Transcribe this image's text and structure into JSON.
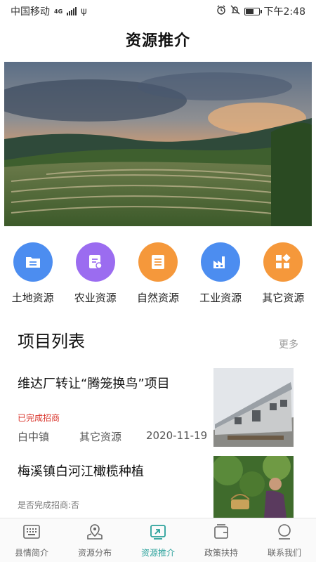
{
  "status_bar": {
    "carrier": "中国移动",
    "network": "4G",
    "time": "下午2:48"
  },
  "header": {
    "title": "资源推介"
  },
  "categories": [
    {
      "label": "土地资源",
      "icon": "folder-icon",
      "color": "#4c8df0"
    },
    {
      "label": "农业资源",
      "icon": "certificate-icon",
      "color": "#9b6cf0"
    },
    {
      "label": "自然资源",
      "icon": "list-icon",
      "color": "#f5983b"
    },
    {
      "label": "工业资源",
      "icon": "factory-icon",
      "color": "#4c8df0"
    },
    {
      "label": "其它资源",
      "icon": "grid-icon",
      "color": "#f5983b"
    }
  ],
  "projects_section": {
    "title": "项目列表",
    "more": "更多"
  },
  "projects": [
    {
      "title": "维达厂转让“腾笼换鸟”项目",
      "status": "已完成招商",
      "status_color": "#d9342b",
      "town": "白中镇",
      "category": "其它资源",
      "date": "2020-11-19"
    },
    {
      "title": "梅溪镇白河江橄榄种植",
      "status": "是否完成招商:否",
      "status_color": "#777"
    }
  ],
  "tabs": [
    {
      "label": "县情简介",
      "icon": "keyboard-icon",
      "active": false
    },
    {
      "label": "资源分布",
      "icon": "map-pin-icon",
      "active": false
    },
    {
      "label": "资源推介",
      "icon": "share-icon",
      "active": true
    },
    {
      "label": "政策扶持",
      "icon": "wallet-icon",
      "active": false
    },
    {
      "label": "联系我们",
      "icon": "user-icon",
      "active": false
    }
  ],
  "colors": {
    "accent": "#2aa19b",
    "inactive": "#666666"
  }
}
